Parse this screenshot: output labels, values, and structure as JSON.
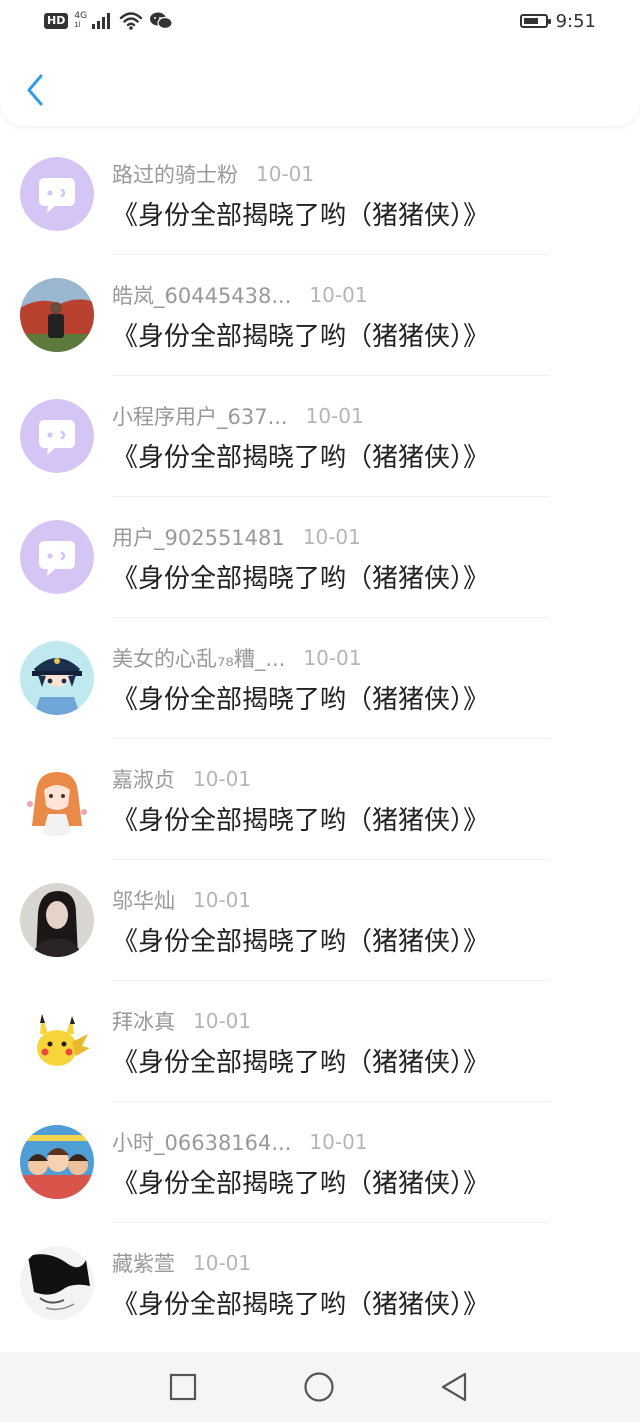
{
  "status_bar": {
    "hd": "HD",
    "network_top": "4G",
    "network_bottom": "1l",
    "time": "9:51"
  },
  "header": {
    "back_icon": "chevron-left-icon",
    "accent": "#2f9de8"
  },
  "comments": [
    {
      "name": "路过的骑士粉",
      "date": "10-01",
      "text": "《身份全部揭晓了哟（猪猪侠）》",
      "avatar": "default"
    },
    {
      "name": "皓岚_60445438...",
      "date": "10-01",
      "text": "《身份全部揭晓了哟（猪猪侠）》",
      "avatar": "photo-red"
    },
    {
      "name": "小程序用户_637...",
      "date": "10-01",
      "text": "《身份全部揭晓了哟（猪猪侠）》",
      "avatar": "default"
    },
    {
      "name": "用户_902551481",
      "date": "10-01",
      "text": "《身份全部揭晓了哟（猪猪侠）》",
      "avatar": "default"
    },
    {
      "name": "美女的心乱₇₈糟_...",
      "date": "10-01",
      "text": "《身份全部揭晓了哟（猪猪侠）》",
      "avatar": "anime-cap"
    },
    {
      "name": "嘉淑贞",
      "date": "10-01",
      "text": "《身份全部揭晓了哟（猪猪侠）》",
      "avatar": "anime-girl"
    },
    {
      "name": "邬华灿",
      "date": "10-01",
      "text": "《身份全部揭晓了哟（猪猪侠）》",
      "avatar": "photo-dark"
    },
    {
      "name": "拜冰真",
      "date": "10-01",
      "text": "《身份全部揭晓了哟（猪猪侠）》",
      "avatar": "pikachu"
    },
    {
      "name": "小时_06638164...",
      "date": "10-01",
      "text": "《身份全部揭晓了哟（猪猪侠）》",
      "avatar": "cartoon-group"
    },
    {
      "name": "藏紫萱",
      "date": "10-01",
      "text": "《身份全部揭晓了哟（猪猪侠）》",
      "avatar": "sketch"
    }
  ],
  "nav": {
    "recent_icon": "square-icon",
    "home_icon": "circle-icon",
    "back_icon": "triangle-back-icon"
  },
  "colors": {
    "default_avatar": "#d4c5f5",
    "name": "#999999",
    "date": "#b5b5b5",
    "message": "#222222"
  }
}
